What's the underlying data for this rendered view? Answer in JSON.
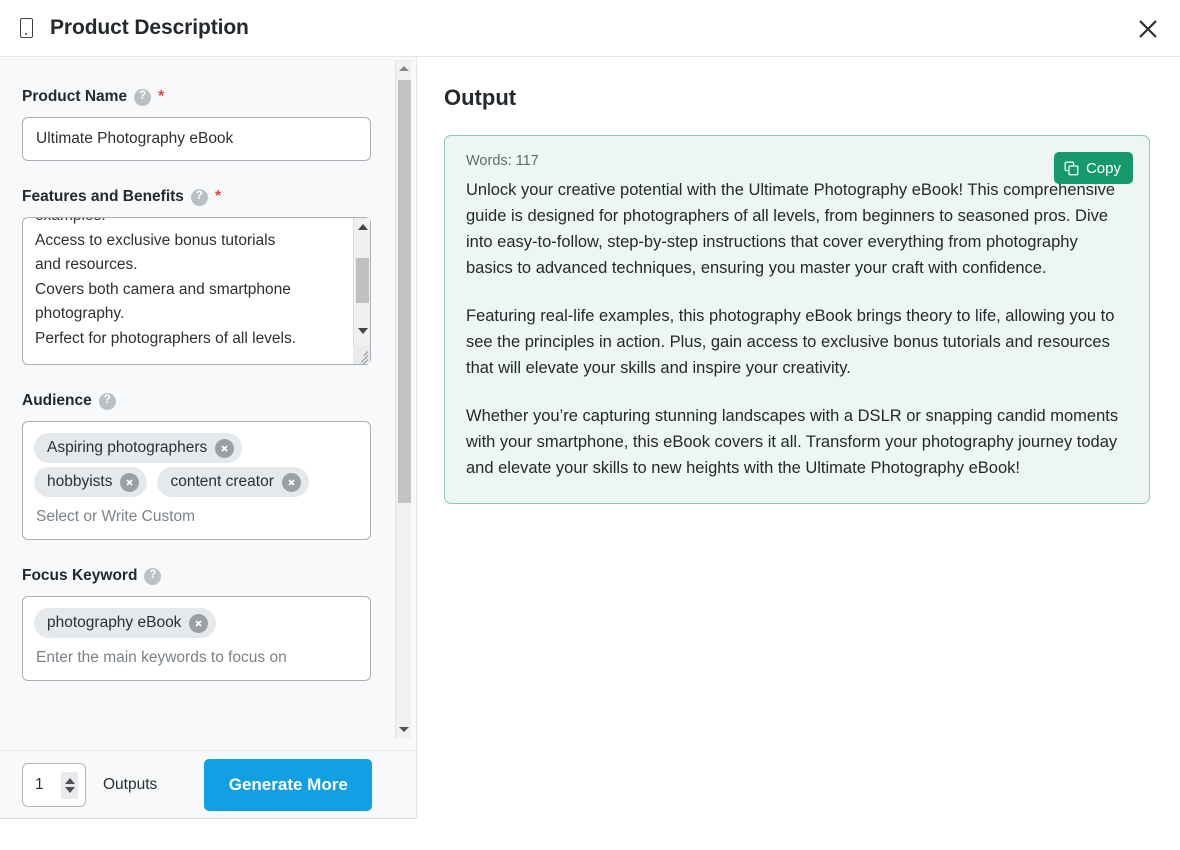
{
  "header": {
    "icon": "device-document-icon",
    "title": "Product Description",
    "close_icon": "close-icon"
  },
  "form": {
    "fields": [
      {
        "label": "Product Name",
        "help_icon": "question-mark-icon",
        "required_marker": "*",
        "type": "text",
        "value": "Ultimate Photography eBook",
        "placeholder": ""
      },
      {
        "label": "Features and Benefits",
        "help_icon": "question-mark-icon",
        "required_marker": "*",
        "type": "textarea",
        "value": "examples.\nAccess to exclusive bonus tutorials\nand resources.\nCovers both camera and smartphone\nphotography.\nPerfect for photographers of all levels."
      },
      {
        "label": "Audience",
        "help_icon": "question-mark-icon",
        "required_marker": "",
        "type": "tags",
        "tags": [
          "Aspiring photographers",
          "hobbyists",
          "content creator"
        ],
        "placeholder": "Select or Write Custom"
      },
      {
        "label": "Focus Keyword",
        "help_icon": "question-mark-icon",
        "required_marker": "",
        "type": "tags",
        "tags": [
          "photography eBook"
        ],
        "placeholder": "Enter the main keywords to focus on"
      }
    ]
  },
  "bottom_bar": {
    "outputs_value": "1",
    "outputs_label": "Outputs",
    "generate_label": "Generate More",
    "generate_color": "#11a0e2"
  },
  "output": {
    "title": "Output",
    "words_label": "Words: 117",
    "copy_label": "Copy",
    "copy_icon": "copy-icon",
    "copy_color": "#17996f",
    "card_bg": "#edf6f2",
    "card_border": "#8fc9b4",
    "paragraphs": [
      "Unlock your creative potential with the Ultimate Photography eBook! This comprehensive guide is designed for photographers of all levels, from beginners to seasoned pros. Dive into easy-to-follow, step-by-step instructions that cover everything from photography basics to advanced techniques, ensuring you master your craft with confidence.",
      "Featuring real-life examples, this photography eBook brings theory to life, allowing you to see the principles in action. Plus, gain access to exclusive bonus tutorials and resources that will elevate your skills and inspire your creativity.",
      "Whether you’re capturing stunning landscapes with a DSLR or snapping candid moments with your smartphone, this eBook covers it all. Transform your photography journey today and elevate your skills to new heights with the Ultimate Photography eBook!"
    ]
  }
}
